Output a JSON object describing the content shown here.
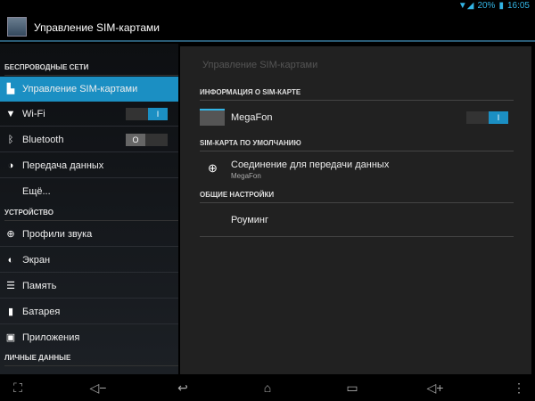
{
  "status": {
    "battery": "20%",
    "time": "16:05"
  },
  "actionbar": {
    "title": "Управление SIM-картами"
  },
  "sidebar": {
    "headers": [
      "БЕСПРОВОДНЫЕ СЕТИ",
      "УСТРОЙСТВО",
      "ЛИЧНЫЕ ДАННЫЕ"
    ],
    "items": [
      {
        "label": "Управление SIM-картами",
        "icon": "sim-icon"
      },
      {
        "label": "Wi-Fi",
        "icon": "wifi-icon",
        "toggle": "on"
      },
      {
        "label": "Bluetooth",
        "icon": "bluetooth-icon",
        "toggle": "off"
      },
      {
        "label": "Передача данных",
        "icon": "data-usage-icon"
      },
      {
        "label": "Ещё..."
      },
      {
        "label": "Профили звука",
        "icon": "sound-icon"
      },
      {
        "label": "Экран",
        "icon": "display-icon"
      },
      {
        "label": "Память",
        "icon": "storage-icon"
      },
      {
        "label": "Батарея",
        "icon": "battery-icon"
      },
      {
        "label": "Приложения",
        "icon": "apps-icon"
      }
    ],
    "toggle_on": "I",
    "toggle_off": "O"
  },
  "panel": {
    "title": "Управление SIM-картами",
    "sections": [
      {
        "header": "ИНФОРМАЦИЯ О SIM-КАРТЕ"
      },
      {
        "header": "SIM-КАРТА ПО УМОЛЧАНИЮ"
      },
      {
        "header": "ОБЩИЕ НАСТРОЙКИ"
      }
    ],
    "sim": {
      "name": "MegaFon",
      "toggle": "I"
    },
    "data_conn": {
      "title": "Соединение для передачи данных",
      "subtitle": "MegaFon"
    },
    "roaming": {
      "title": "Роуминг"
    }
  },
  "accent": "#1b8fc3"
}
